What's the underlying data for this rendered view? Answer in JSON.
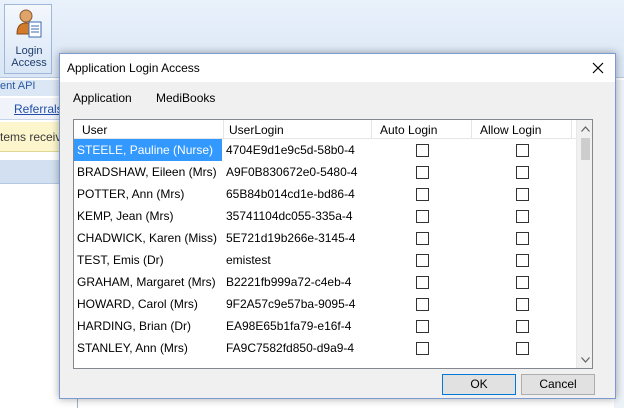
{
  "background": {
    "ribbon_button_label": "Login\nAccess",
    "api_label": "ent API",
    "referrals_link": "Referrals",
    "items_text": "tems receiv"
  },
  "dialog": {
    "title": "Application Login Access",
    "menu": [
      "Application",
      "MediBooks"
    ],
    "columns": [
      "User",
      "UserLogin",
      "Auto Login",
      "Allow Login"
    ],
    "rows": [
      {
        "user": "STEELE, Pauline (Nurse)",
        "login": "4704E9d1e9c5d-58b0-4",
        "selected": true
      },
      {
        "user": "BRADSHAW, Eileen (Mrs)",
        "login": "A9F0B830672e0-5480-4"
      },
      {
        "user": "POTTER, Ann (Mrs)",
        "login": "65B84b014cd1e-bd86-4"
      },
      {
        "user": "KEMP, Jean (Mrs)",
        "login": "35741104dc055-335a-4"
      },
      {
        "user": "CHADWICK, Karen (Miss)",
        "login": "5E721d19b266e-3145-4"
      },
      {
        "user": "TEST, Emis (Dr)",
        "login": "emistest"
      },
      {
        "user": "GRAHAM, Margaret (Mrs)",
        "login": "B2221fb999a72-c4eb-4"
      },
      {
        "user": "HOWARD, Carol (Mrs)",
        "login": "9F2A57c9e57ba-9095-4"
      },
      {
        "user": "HARDING, Brian (Dr)",
        "login": "EA98E65b1fa79-e16f-4"
      },
      {
        "user": "STANLEY, Ann (Mrs)",
        "login": "FA9C7582fd850-d9a9-4"
      }
    ],
    "ok_label": "OK",
    "cancel_label": "Cancel"
  },
  "colors": {
    "selection": "#3399ff",
    "focus_border": "#0078d7"
  }
}
